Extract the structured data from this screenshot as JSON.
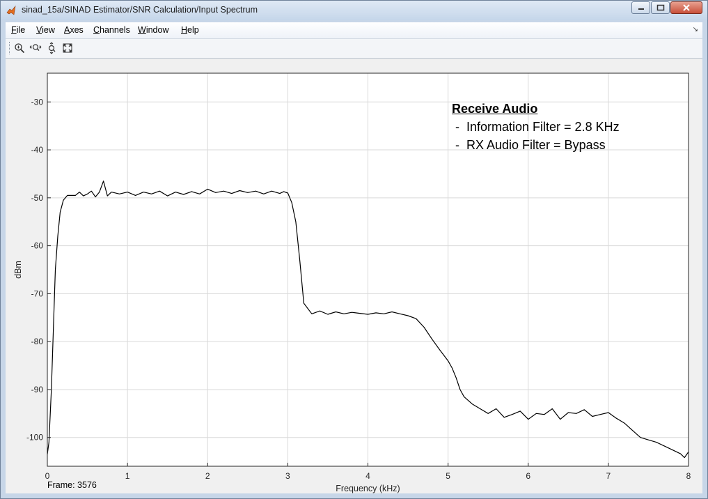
{
  "window": {
    "title": "sinad_15a/SINAD Estimator/SNR Calculation/Input Spectrum"
  },
  "menu": [
    {
      "label": "File",
      "key": "F",
      "rest": "ile"
    },
    {
      "label": "View",
      "key": "V",
      "rest": "iew"
    },
    {
      "label": "Axes",
      "key": "A",
      "rest": "xes"
    },
    {
      "label": "Channels",
      "key": "C",
      "rest": "hannels"
    },
    {
      "label": "Window",
      "key": "W",
      "rest": "indow"
    },
    {
      "label": "Help",
      "key": "H",
      "rest": "elp"
    }
  ],
  "toolbar": [
    "zoom-in-icon",
    "zoom-x-icon",
    "zoom-y-icon",
    "autoscale-icon"
  ],
  "status": {
    "frame": "Frame: 3576"
  },
  "annotation": {
    "heading": "Receive Audio",
    "line1": " -  Information Filter = 2.8 KHz",
    "line2": " -  RX Audio Filter = Bypass"
  },
  "chart_data": {
    "type": "line",
    "xlabel": "Frequency (kHz)",
    "ylabel": "dBm",
    "xlim": [
      0,
      8
    ],
    "ylim": [
      -106,
      -24
    ],
    "xticks": [
      0,
      1,
      2,
      3,
      4,
      5,
      6,
      7,
      8
    ],
    "yticks": [
      -30,
      -40,
      -50,
      -60,
      -70,
      -80,
      -90,
      -100
    ],
    "grid": true,
    "line_color": "#000000",
    "series": [
      {
        "x": [
          0.0,
          0.02,
          0.05,
          0.08,
          0.1,
          0.13,
          0.16,
          0.2,
          0.25,
          0.3,
          0.35,
          0.4,
          0.45,
          0.5,
          0.55,
          0.6,
          0.65,
          0.7,
          0.75,
          0.8,
          0.9,
          1.0,
          1.1,
          1.2,
          1.3,
          1.4,
          1.5,
          1.6,
          1.7,
          1.8,
          1.9,
          2.0,
          2.1,
          2.2,
          2.3,
          2.4,
          2.5,
          2.6,
          2.7,
          2.8,
          2.9,
          2.95,
          3.0,
          3.05,
          3.1,
          3.15,
          3.2,
          3.3,
          3.4,
          3.5,
          3.6,
          3.7,
          3.8,
          3.9,
          4.0,
          4.1,
          4.2,
          4.3,
          4.4,
          4.5,
          4.6,
          4.7,
          4.8,
          4.9,
          5.0,
          5.05,
          5.1,
          5.15,
          5.2,
          5.3,
          5.4,
          5.5,
          5.6,
          5.7,
          5.8,
          5.9,
          6.0,
          6.1,
          6.2,
          6.3,
          6.4,
          6.5,
          6.6,
          6.7,
          6.8,
          6.9,
          7.0,
          7.1,
          7.2,
          7.3,
          7.4,
          7.5,
          7.6,
          7.7,
          7.8,
          7.9,
          7.95,
          8.0
        ],
        "y": [
          -103.5,
          -101,
          -90,
          -75,
          -65,
          -58,
          -53,
          -50.5,
          -49.5,
          -49.5,
          -49.5,
          -48.8,
          -49.6,
          -49.2,
          -48.6,
          -49.8,
          -48.8,
          -46.5,
          -49.6,
          -48.8,
          -49.2,
          -48.8,
          -49.5,
          -48.8,
          -49.2,
          -48.6,
          -49.6,
          -48.8,
          -49.3,
          -48.7,
          -49.2,
          -48.2,
          -48.9,
          -48.6,
          -49.1,
          -48.5,
          -48.9,
          -48.6,
          -49.2,
          -48.6,
          -49.1,
          -48.7,
          -49.0,
          -51,
          -55,
          -63,
          -72,
          -74.2,
          -73.6,
          -74.3,
          -73.8,
          -74.2,
          -73.9,
          -74.1,
          -74.3,
          -74.0,
          -74.2,
          -73.8,
          -74.2,
          -74.6,
          -75.2,
          -77.0,
          -79.5,
          -81.8,
          -84.0,
          -85.5,
          -87.5,
          -90.0,
          -91.5,
          -93.0,
          -94.0,
          -95.0,
          -94.0,
          -95.8,
          -95.2,
          -94.5,
          -96.2,
          -95.0,
          -95.2,
          -94.0,
          -96.2,
          -94.8,
          -95.0,
          -94.2,
          -95.6,
          -95.2,
          -94.8,
          -96.0,
          -97.0,
          -98.5,
          -100.0,
          -100.5,
          -101.0,
          -101.8,
          -102.6,
          -103.4,
          -104.2,
          -103.0
        ]
      }
    ]
  }
}
